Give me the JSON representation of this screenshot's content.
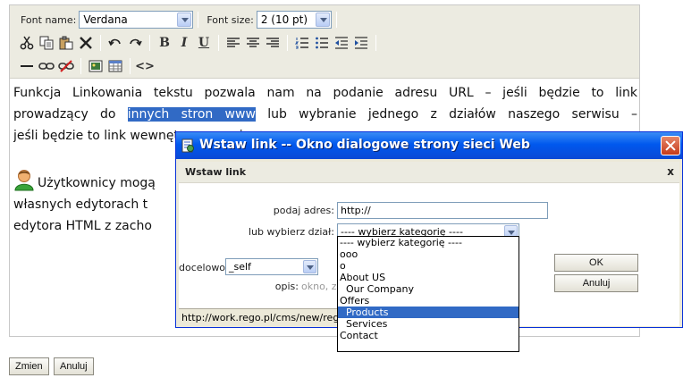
{
  "editor": {
    "toolbar": {
      "font_name_label": "Font name:",
      "font_name_value": "Verdana",
      "font_size_label": "Font size:",
      "font_size_value": "2 (10 pt)",
      "icons": [
        "cut-icon",
        "copy-icon",
        "paste-icon",
        "delete-icon",
        "undo-icon",
        "redo-icon",
        "bold-icon",
        "italic-icon",
        "underline-icon",
        "align-left-icon",
        "align-center-icon",
        "align-right-icon",
        "ordered-list-icon",
        "unordered-list-icon",
        "outdent-icon",
        "indent-icon",
        "horizontal-rule-icon",
        "link-icon",
        "unlink-icon",
        "image-icon",
        "table-icon",
        "source-code-icon"
      ],
      "bold_glyph": "B",
      "italic_glyph": "I",
      "underline_glyph": "U",
      "source_glyph": "<>"
    },
    "content": {
      "line1": "Funkcja Linkowania tekstu pozwala nam na podanie adresu URL – jeśli będzie to link",
      "line2_before": "prowadzący do",
      "line2_highlight": "innych stron www",
      "line2_after": "lub wybranie jednego z działów naszego serwisu –",
      "line3": "jeśli będzie to link wewnętrzny serwisu.",
      "line5": "Użytkownicy mogą",
      "line6": "własnych edytorach t",
      "line7": "edytora HTML z zacho"
    }
  },
  "buttons": {
    "save_label": "Zmien",
    "cancel_label": "Anuluj"
  },
  "dialog": {
    "title": "Wstaw link -- Okno dialogowe strony sieci Web",
    "heading": "Wstaw link",
    "close_x": "x",
    "address_label": "podaj adres:",
    "address_value": "http://",
    "category_label": "lub wybierz dział:",
    "category_value": "---- wybierz kategorię ----",
    "target_label": "docelowo:",
    "target_value": "_self",
    "desc_label": "opis:",
    "desc_placeholder": "okno, z którego",
    "ok_label": "OK",
    "cancel_label": "Anuluj",
    "status_text": "http://work.rego.pl/cms/new/reg"
  },
  "dropdown": {
    "options": [
      "---- wybierz kategorię ----",
      "ooo",
      "o",
      "About US",
      "  Our Company",
      "Offers",
      "  Products",
      "  Services",
      "Contact"
    ],
    "selected_index": 6
  },
  "colors": {
    "selection": "#316ac5",
    "titlebar": "#0058ee",
    "toolbar_bg": "#ecebe1"
  }
}
